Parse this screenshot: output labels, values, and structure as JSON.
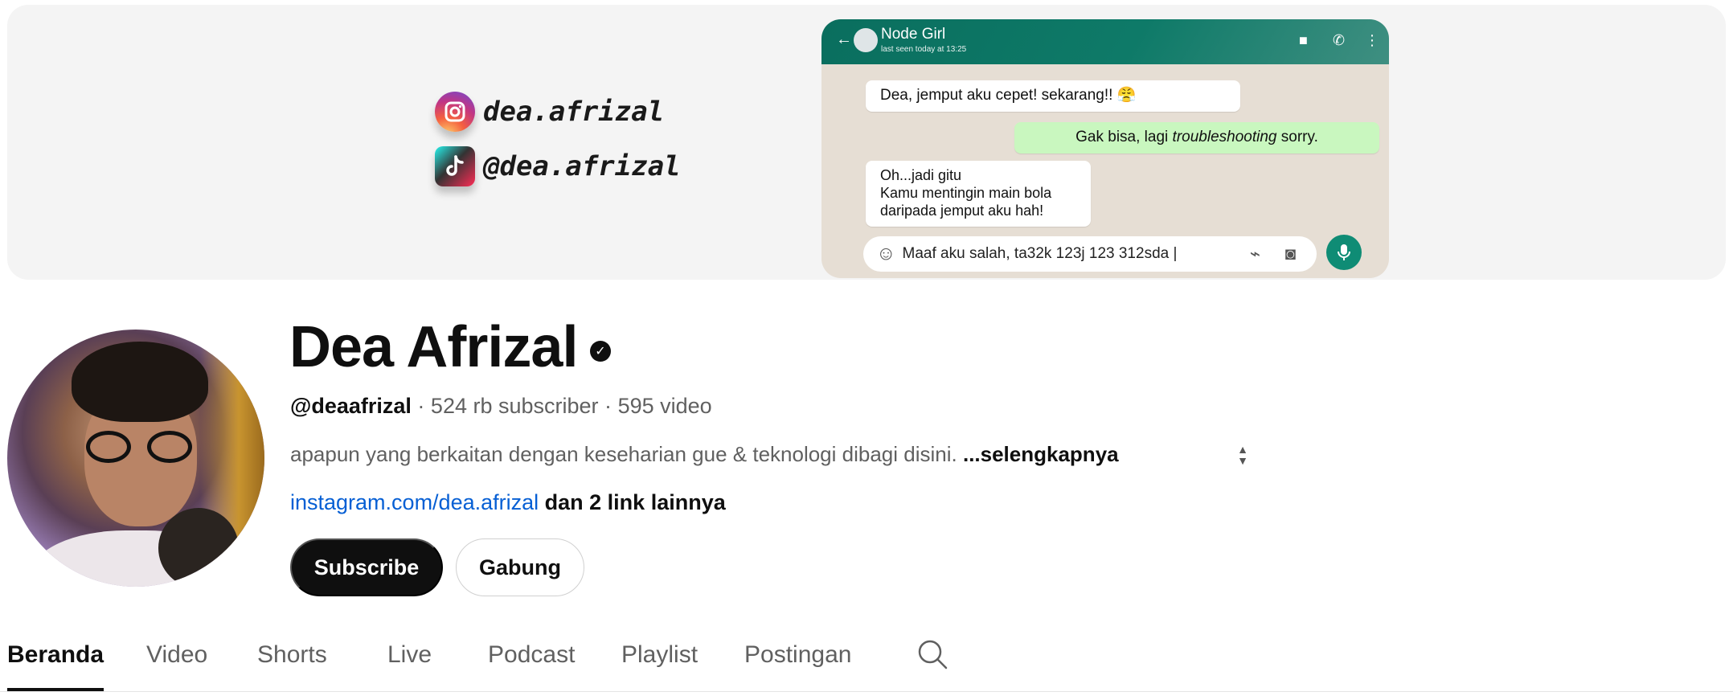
{
  "banner": {
    "instagram_handle": "dea.afrizal",
    "tiktok_handle": "@dea.afrizal",
    "chat": {
      "contact_name": "Node Girl",
      "last_seen": "last seen today at 13:25",
      "messages": [
        {
          "direction": "in",
          "text": "Dea, jemput aku cepet! sekarang!! 😤"
        },
        {
          "direction": "out",
          "text_prefix": "Gak bisa, lagi ",
          "text_emphasis": "troubleshooting",
          "text_suffix": " sorry."
        },
        {
          "direction": "in",
          "lines": [
            "Oh...jadi gitu",
            "Kamu mentingin main bola",
            "daripada jemput aku hah!"
          ]
        }
      ],
      "input_text": "Maaf aku salah, ta32k 123j 123 312sda |"
    }
  },
  "channel": {
    "name": "Dea Afrizal",
    "handle": "@deaafrizal",
    "subscribers": "524 rb subscriber",
    "videos": "595 video",
    "separator": "·",
    "description": "apapun yang berkaitan dengan keseharian gue & teknologi dibagi disini.",
    "more_label": "...selengkapnya",
    "link": "instagram.com/dea.afrizal",
    "more_links": "dan 2 link lainnya",
    "subscribe_label": "Subscribe",
    "join_label": "Gabung"
  },
  "tabs": [
    {
      "label": "Beranda",
      "active": true
    },
    {
      "label": "Video",
      "active": false
    },
    {
      "label": "Shorts",
      "active": false
    },
    {
      "label": "Live",
      "active": false
    },
    {
      "label": "Podcast",
      "active": false
    },
    {
      "label": "Playlist",
      "active": false
    },
    {
      "label": "Postingan",
      "active": false
    }
  ],
  "icons": {
    "verified": "verified-check-icon",
    "search": "search-icon",
    "sort": "sort-arrows-icon"
  },
  "colors": {
    "link": "#065fd4",
    "subscribe_bg": "#0f0f0f",
    "whatsapp_header": "#0a6e5e"
  }
}
